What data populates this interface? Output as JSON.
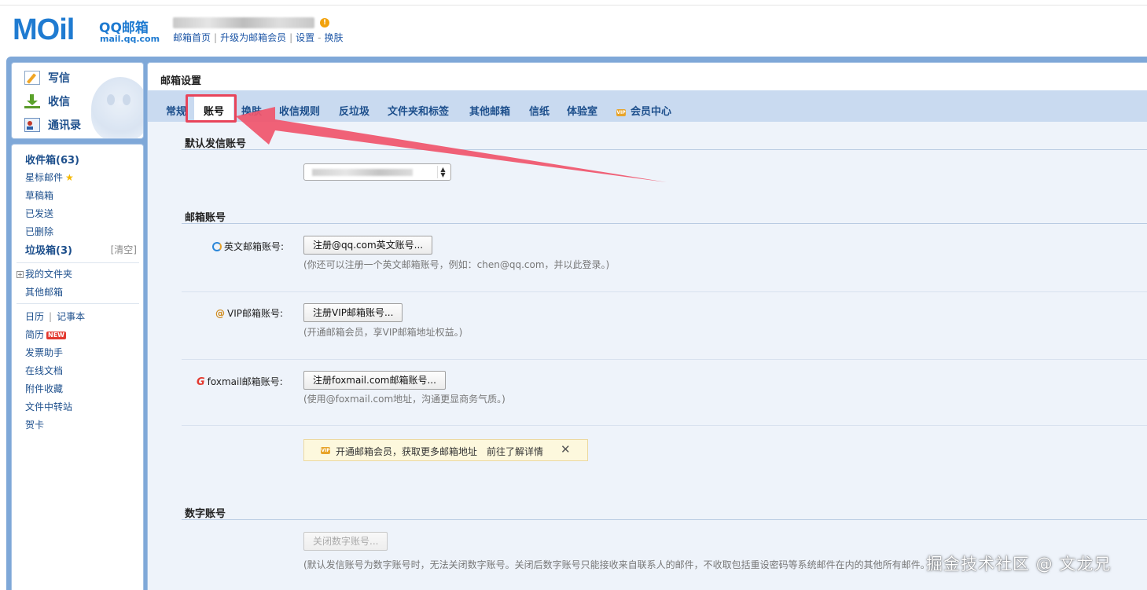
{
  "header": {
    "logo_mail": "MOil",
    "logo_qq": "QQ邮箱",
    "logo_url": "mail.qq.com",
    "warn_badge": "!",
    "links": [
      "邮箱首页",
      "升级为邮箱会员",
      "设置",
      "换肤"
    ]
  },
  "quick_actions": [
    {
      "label": "写信",
      "icon": "compose-icon"
    },
    {
      "label": "收信",
      "icon": "receive-icon"
    },
    {
      "label": "通讯录",
      "icon": "contacts-icon"
    }
  ],
  "sidebar": {
    "inbox": "收件箱(63)",
    "starred": "星标邮件",
    "drafts": "草稿箱",
    "sent": "已发送",
    "deleted": "已删除",
    "spam": "垃圾箱(3)",
    "spam_clean": "[清空]",
    "my_folders": "我的文件夹",
    "other_mail": "其他邮箱",
    "calendar": "日历",
    "notepad": "记事本",
    "resume": "简历",
    "resume_badge": "NEW",
    "invoice": "发票助手",
    "online_docs": "在线文档",
    "attachments": "附件收藏",
    "file_transfer": "文件中转站",
    "cards": "贺卡"
  },
  "main": {
    "title": "邮箱设置",
    "tabs": [
      "常规",
      "账号",
      "换肤",
      "收信规则",
      "反垃圾",
      "文件夹和标签",
      "其他邮箱",
      "信纸",
      "体验室",
      "会员中心"
    ],
    "active_tab": "账号",
    "vip_icon_text": "VIP"
  },
  "settings": {
    "default_sender_title": "默认发信账号",
    "mail_account_title": "邮箱账号",
    "english_label": "英文邮箱账号:",
    "english_button": "注册@qq.com英文账号...",
    "english_hint": "(你还可以注册一个英文邮箱账号，例如：chen@qq.com，并以此登录。)",
    "vip_label": "VIP邮箱账号:",
    "vip_button": "注册VIP邮箱账号...",
    "vip_hint": "(开通邮箱会员，享VIP邮箱地址权益。)",
    "foxmail_label": "foxmail邮箱账号:",
    "foxmail_button": "注册foxmail.com邮箱账号...",
    "foxmail_hint": "(使用@foxmail.com地址，沟通更显商务气质。)",
    "promo_text": "开通邮箱会员，获取更多邮箱地址",
    "promo_link": "前往了解详情",
    "promo_close": "✕",
    "digital_title": "数字账号",
    "digital_button": "关闭数字账号...",
    "digital_hint": "(默认发信账号为数字账号时，无法关闭数字账号。关闭后数字账号只能接收来自联系人的邮件，不收取包括重设密码等系统邮件在内的其他所有邮件。"
  },
  "watermark": "掘金技术社区 @ 文龙兄",
  "colors": {
    "accent": "#1f7bd1",
    "frame": "#7fa8d8",
    "tabbar": "#c9daf0",
    "content_bg": "#eef3fa",
    "annotation_red": "#e8445a"
  }
}
